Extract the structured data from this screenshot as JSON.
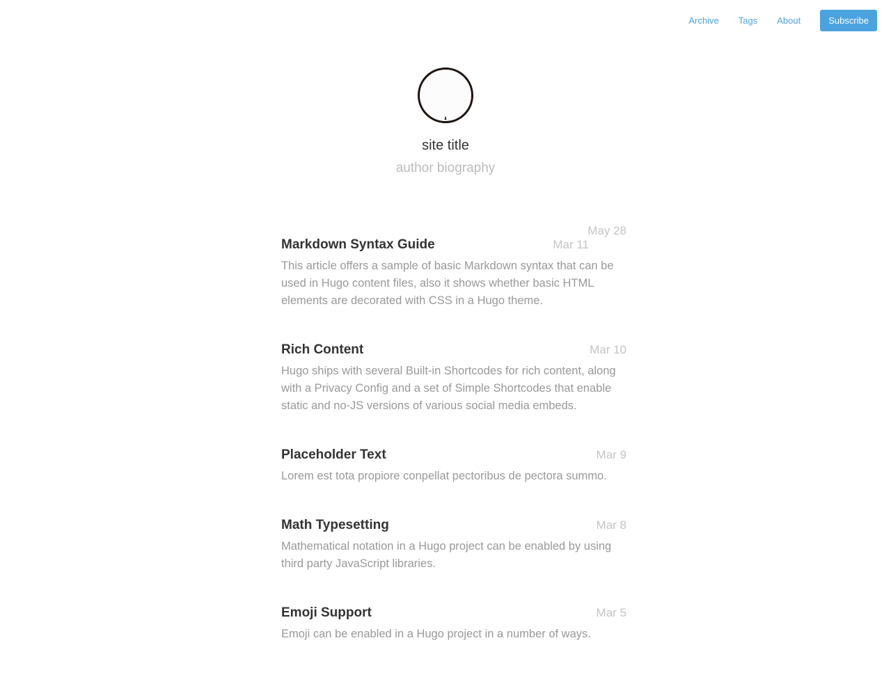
{
  "nav": {
    "links": [
      "Archive",
      "Tags",
      "About"
    ],
    "subscribe_label": "Subscribe"
  },
  "hero": {
    "site_title": "site title",
    "bio": "author biography"
  },
  "stray_date": "May 28",
  "posts": [
    {
      "title": "Markdown Syntax Guide",
      "date": "Mar 11",
      "summary": "This article offers a sample of basic Markdown syntax that can be used in Hugo content files, also it shows whether basic HTML elements are decorated with CSS in a Hugo theme."
    },
    {
      "title": "Rich Content",
      "date": "Mar 10",
      "summary": "Hugo ships with several Built-in Shortcodes for rich content, along with a Privacy Config and a set of Simple Shortcodes that enable static and no-JS versions of various social media embeds."
    },
    {
      "title": "Placeholder Text",
      "date": "Mar 9",
      "summary": "Lorem est tota propiore conpellat pectoribus de pectora summo."
    },
    {
      "title": "Math Typesetting",
      "date": "Mar 8",
      "summary": "Mathematical notation in a Hugo project can be enabled by using third party JavaScript libraries."
    },
    {
      "title": "Emoji Support",
      "date": "Mar 5",
      "summary": "Emoji can be enabled in a Hugo project in a number of ways."
    }
  ],
  "colors": {
    "accent": "#4aa3df",
    "title": "#333333",
    "muted": "#999999",
    "date": "#c4c4c4"
  }
}
